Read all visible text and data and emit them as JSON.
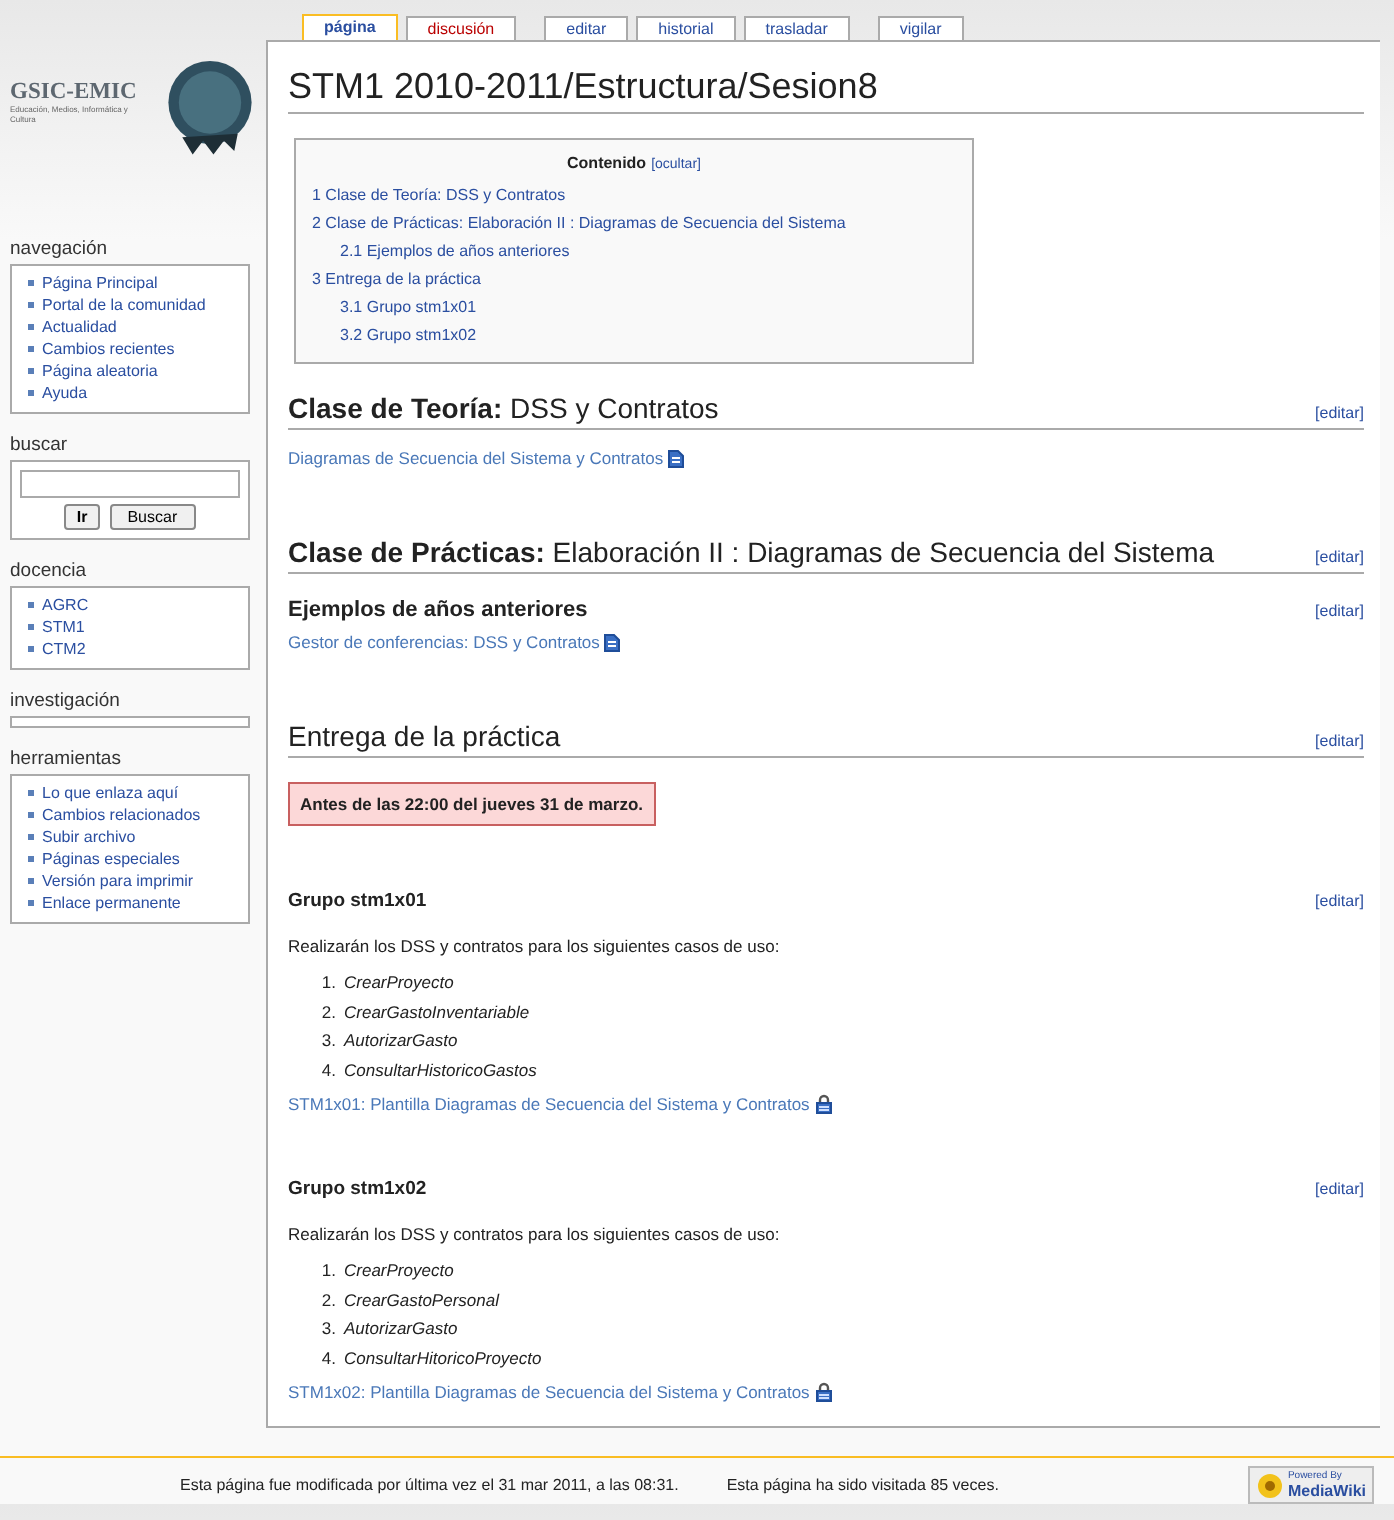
{
  "logo": {
    "name": "GSIC-EMIC",
    "tagline": "Educación, Medios, Informática y Cultura"
  },
  "tabs": [
    {
      "label": "página",
      "selected": true,
      "missing": false
    },
    {
      "label": "discusión",
      "selected": false,
      "missing": true
    },
    {
      "label": "editar",
      "selected": false,
      "missing": false
    },
    {
      "label": "historial",
      "selected": false,
      "missing": false
    },
    {
      "label": "trasladar",
      "selected": false,
      "missing": false
    },
    {
      "label": "vigilar",
      "selected": false,
      "missing": false
    }
  ],
  "sidebar": [
    {
      "title": "navegación",
      "kind": "links",
      "items": [
        "Página Principal",
        "Portal de la comunidad",
        "Actualidad",
        "Cambios recientes",
        "Página aleatoria",
        "Ayuda"
      ]
    },
    {
      "title": "buscar",
      "kind": "search",
      "buttons": [
        "Ir",
        "Buscar"
      ]
    },
    {
      "title": "docencia",
      "kind": "links",
      "items": [
        "AGRC",
        "STM1",
        "CTM2"
      ]
    },
    {
      "title": "investigación",
      "kind": "links"
    },
    {
      "title": "herramientas",
      "kind": "links",
      "items": [
        "Lo que enlaza aquí",
        "Cambios relacionados",
        "Subir archivo",
        "Páginas especiales",
        "Versión para imprimir",
        "Enlace permanente"
      ]
    }
  ],
  "page": {
    "title": "STM1 2010-2011/Estructura/Sesion8",
    "toc": {
      "title": "Contenido",
      "toggle": "[ocultar]",
      "items": [
        {
          "number": "1",
          "text": "Clase de Teoría: DSS y Contratos"
        },
        {
          "number": "2",
          "text": "Clase de Prácticas: Elaboración II : Diagramas de Secuencia del Sistema",
          "children": [
            {
              "number": "2.1",
              "text": "Ejemplos de años anteriores"
            }
          ]
        },
        {
          "number": "3",
          "text": "Entrega de la práctica",
          "children": [
            {
              "number": "3.1",
              "text": "Grupo stm1x01"
            },
            {
              "number": "3.2",
              "text": "Grupo stm1x02"
            }
          ]
        }
      ]
    },
    "sections": [
      {
        "kind": "heading",
        "title": "**Clase de Teoría:** DSS y Contratos",
        "edit": "[editar]",
        "blocks": [
          {
            "kind": "file-link",
            "text": "Diagramas de Secuencia del Sistema y Contratos"
          }
        ]
      },
      {
        "kind": "heading",
        "title": "**Clase de Prácticas:** Elaboración II : Diagramas de Secuencia del Sistema",
        "edit": "[editar]"
      },
      {
        "kind": "subheading",
        "title": "Ejemplos de años anteriores",
        "edit": "[editar]",
        "blocks": [
          {
            "kind": "file-link",
            "text": "Gestor de conferencias: DSS y Contratos"
          }
        ]
      },
      {
        "kind": "heading",
        "title": "Entrega de la práctica",
        "edit": "[editar]",
        "blocks": [
          {
            "kind": "notice",
            "text": "Antes de las 22:00 del jueves 31 de marzo."
          }
        ]
      },
      {
        "kind": "minor-heading",
        "title": "Grupo stm1x01",
        "edit": "[editar]",
        "blocks": [
          {
            "kind": "paragraph",
            "text": "Realizarán los DSS y contratos para los siguientes casos de uso:"
          },
          {
            "kind": "list",
            "items": [
              {
                "number": "1.",
                "text": "CrearProyecto"
              },
              {
                "number": "2.",
                "text": "CrearGastoInventariable"
              },
              {
                "number": "3.",
                "text": "AutorizarGasto"
              },
              {
                "number": "4.",
                "text": "ConsultarHistoricoGastos"
              }
            ]
          },
          {
            "kind": "locked-link",
            "text": "STM1x01: Plantilla Diagramas de Secuencia del Sistema y Contratos"
          }
        ]
      },
      {
        "kind": "minor-heading",
        "title": "Grupo stm1x02",
        "edit": "[editar]",
        "blocks": [
          {
            "kind": "paragraph",
            "text": "Realizarán los DSS y contratos para los siguientes casos de uso:"
          },
          {
            "kind": "list",
            "items": [
              {
                "number": "1.",
                "text": "CrearProyecto"
              },
              {
                "number": "2.",
                "text": "CrearGastoPersonal"
              },
              {
                "number": "3.",
                "text": "AutorizarGasto"
              },
              {
                "number": "4.",
                "text": "ConsultarHitoricoProyecto"
              }
            ]
          },
          {
            "kind": "locked-link",
            "text": "STM1x02: Plantilla Diagramas de Secuencia del Sistema y Contratos"
          }
        ]
      }
    ]
  },
  "footer": {
    "modified": "Esta página fue modificada por última vez el 31 mar 2011, a las 08:31.",
    "views": "Esta página ha sido visitada 85 veces.",
    "badge_top": "Powered By",
    "badge_name": "MediaWiki"
  }
}
